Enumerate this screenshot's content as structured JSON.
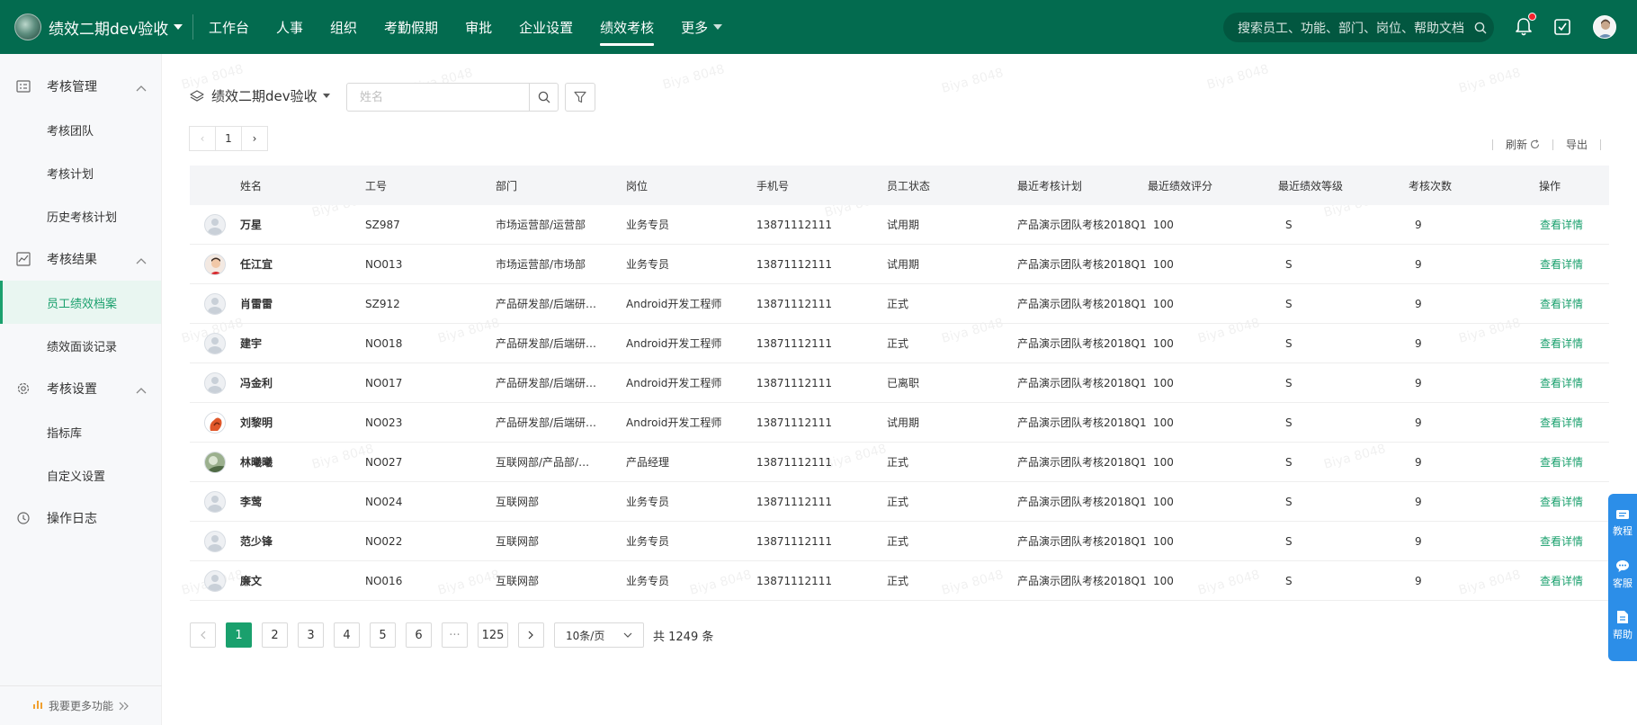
{
  "app": {
    "title": "绩效二期dev验收"
  },
  "nav": {
    "items": [
      "工作台",
      "人事",
      "组织",
      "考勤假期",
      "审批",
      "企业设置",
      "绩效考核",
      "更多"
    ],
    "active": "绩效考核"
  },
  "global_search": {
    "placeholder": "搜索员工、功能、部门、岗位、帮助文档"
  },
  "sidebar": {
    "groups": [
      {
        "label": "考核管理",
        "items": [
          "考核团队",
          "考核计划",
          "历史考核计划"
        ]
      },
      {
        "label": "考核结果",
        "items": [
          "员工绩效档案",
          "绩效面谈记录"
        ]
      },
      {
        "label": "考核设置",
        "items": [
          "指标库",
          "自定义设置"
        ]
      },
      {
        "label": "操作日志",
        "items": []
      }
    ],
    "active_item": "员工绩效档案",
    "footer": "我要更多功能"
  },
  "toolbar": {
    "company": "绩效二期dev验收",
    "name_placeholder": "姓名",
    "mini_page": "1",
    "refresh": "刷新",
    "export": "导出"
  },
  "watermark": "Biya 8048",
  "table": {
    "headers": [
      "姓名",
      "工号",
      "部门",
      "岗位",
      "手机号",
      "员工状态",
      "最近考核计划",
      "最近绩效评分",
      "最近绩效等级",
      "考核次数",
      "操作"
    ],
    "rows": [
      {
        "name": "万星",
        "id": "SZ987",
        "dept": "市场运营部/运营部",
        "pos": "业务专员",
        "phone": "13871112111",
        "status": "试用期",
        "plan": "产品演示团队考核2018Q1",
        "score": "100",
        "grade": "S",
        "count": "9",
        "op": "查看详情"
      },
      {
        "name": "任江宜",
        "id": "NO013",
        "dept": "市场运营部/市场部",
        "pos": "业务专员",
        "phone": "13871112111",
        "status": "试用期",
        "plan": "产品演示团队考核2018Q1",
        "score": "100",
        "grade": "S",
        "count": "9",
        "op": "查看详情"
      },
      {
        "name": "肖雷雷",
        "id": "SZ912",
        "dept": "产品研发部/后端研…",
        "pos": "Android开发工程师",
        "phone": "13871112111",
        "status": "正式",
        "plan": "产品演示团队考核2018Q1",
        "score": "100",
        "grade": "S",
        "count": "9",
        "op": "查看详情"
      },
      {
        "name": "建宇",
        "id": "NO018",
        "dept": "产品研发部/后端研…",
        "pos": "Android开发工程师",
        "phone": "13871112111",
        "status": "正式",
        "plan": "产品演示团队考核2018Q1",
        "score": "100",
        "grade": "S",
        "count": "9",
        "op": "查看详情"
      },
      {
        "name": "冯金利",
        "id": "NO017",
        "dept": "产品研发部/后端研…",
        "pos": "Android开发工程师",
        "phone": "13871112111",
        "status": "已离职",
        "plan": "产品演示团队考核2018Q1",
        "score": "100",
        "grade": "S",
        "count": "9",
        "op": "查看详情"
      },
      {
        "name": "刘黎明",
        "id": "NO023",
        "dept": "产品研发部/后端研…",
        "pos": "Android开发工程师",
        "phone": "13871112111",
        "status": "试用期",
        "plan": "产品演示团队考核2018Q1",
        "score": "100",
        "grade": "S",
        "count": "9",
        "op": "查看详情"
      },
      {
        "name": "林曦曦",
        "id": "NO027",
        "dept": "互联网部/产品部/…",
        "pos": "产品经理",
        "phone": "13871112111",
        "status": "正式",
        "plan": "产品演示团队考核2018Q1",
        "score": "100",
        "grade": "S",
        "count": "9",
        "op": "查看详情"
      },
      {
        "name": "李莺",
        "id": "NO024",
        "dept": "互联网部",
        "pos": "业务专员",
        "phone": "13871112111",
        "status": "正式",
        "plan": "产品演示团队考核2018Q1",
        "score": "100",
        "grade": "S",
        "count": "9",
        "op": "查看详情"
      },
      {
        "name": "范少锋",
        "id": "NO022",
        "dept": "互联网部",
        "pos": "业务专员",
        "phone": "13871112111",
        "status": "正式",
        "plan": "产品演示团队考核2018Q1",
        "score": "100",
        "grade": "S",
        "count": "9",
        "op": "查看详情"
      },
      {
        "name": "廉文",
        "id": "NO016",
        "dept": "互联网部",
        "pos": "业务专员",
        "phone": "13871112111",
        "status": "正式",
        "plan": "产品演示团队考核2018Q1",
        "score": "100",
        "grade": "S",
        "count": "9",
        "op": "查看详情"
      }
    ]
  },
  "pagination": {
    "pages": [
      "1",
      "2",
      "3",
      "4",
      "5",
      "6"
    ],
    "ellipsis": "···",
    "last_page": "125",
    "current": "1",
    "page_size": "10条/页",
    "total": "共 1249 条"
  },
  "float_bar": {
    "items": [
      "教程",
      "客服",
      "帮助"
    ]
  },
  "colors": {
    "topbar": "#036b4f",
    "accent": "#1aa06d",
    "float_bar": "#2c8ee8"
  }
}
